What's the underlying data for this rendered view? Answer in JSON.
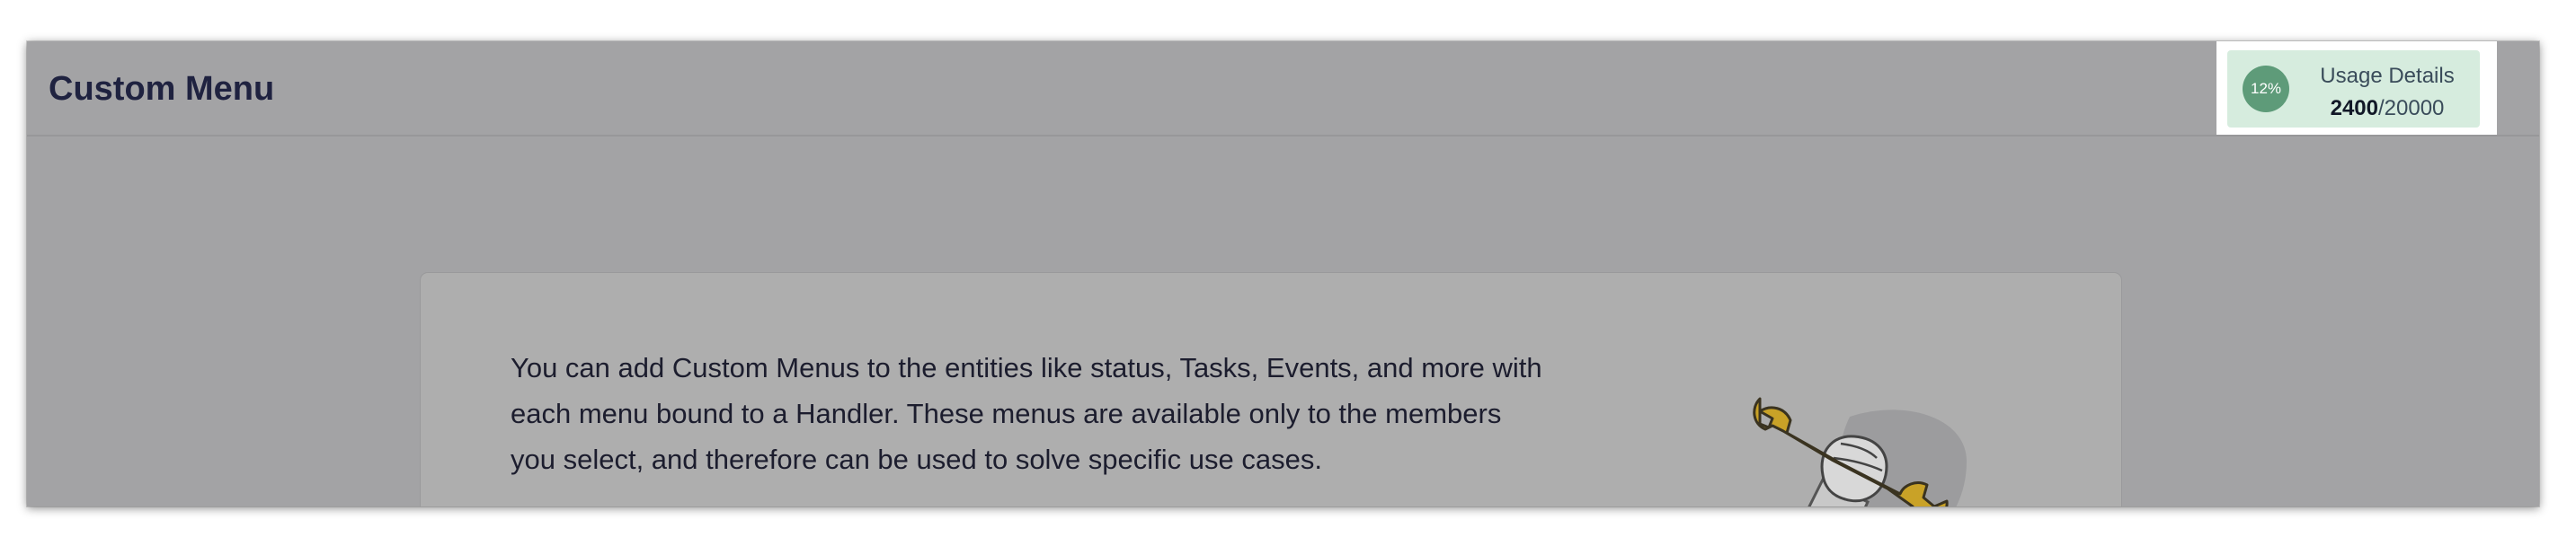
{
  "header": {
    "title": "Custom Menu"
  },
  "usage": {
    "percent_label": "12%",
    "percent": 12,
    "label": "Usage Details",
    "used": "2400",
    "separator": "/",
    "limit": "20000"
  },
  "content": {
    "description": "You can add Custom Menus to the entities like status, Tasks, Events, and more with each menu bound to a Handler. These menus are available only to the members you select, and therefore can be used to solve specific use cases.",
    "illustration_icon": "wrench-hand-illustration"
  },
  "colors": {
    "overlay_background": "#a3a3a5",
    "title_text": "#1f2240",
    "usage_card": "#d6ecde",
    "usage_circle": "#5e9b79",
    "wrench": "#c9a227"
  }
}
